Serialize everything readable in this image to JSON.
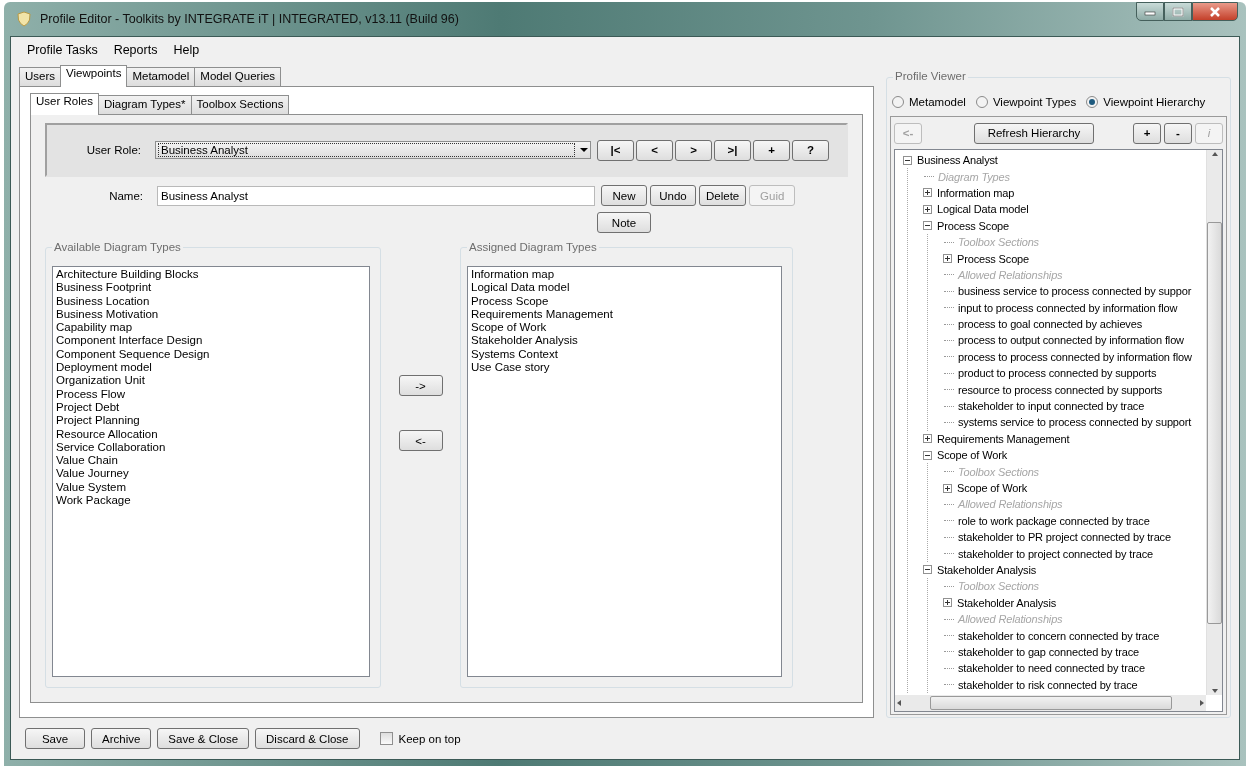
{
  "window": {
    "title": "Profile Editor - Toolkits by INTEGRATE iT | INTEGRATED, v13.11 (Build 96)"
  },
  "menu": [
    "Profile Tasks",
    "Reports",
    "Help"
  ],
  "tabs": [
    {
      "label": "Users",
      "selected": false
    },
    {
      "label": "Viewpoints",
      "selected": true
    },
    {
      "label": "Metamodel",
      "selected": false
    },
    {
      "label": "Model Queries",
      "selected": false
    }
  ],
  "subtabs": [
    {
      "label": "User Roles",
      "selected": true
    },
    {
      "label": "Diagram Types*",
      "selected": false
    },
    {
      "label": "Toolbox Sections",
      "selected": false
    }
  ],
  "user_role": {
    "label": "User Role:",
    "value": "Business Analyst"
  },
  "nav_buttons": [
    "|<",
    "<",
    ">",
    ">|",
    "+",
    "?"
  ],
  "name_field": {
    "label": "Name:",
    "value": "Business Analyst"
  },
  "name_buttons": [
    {
      "label": "New",
      "disabled": false
    },
    {
      "label": "Undo",
      "disabled": false
    },
    {
      "label": "Delete",
      "disabled": false
    },
    {
      "label": "Guid",
      "disabled": true
    }
  ],
  "note_button": "Note",
  "available": {
    "title": "Available Diagram Types",
    "items": [
      "Architecture Building Blocks",
      "Business Footprint",
      "Business Location",
      "Business Motivation",
      "Capability map",
      "Component Interface Design",
      "Component Sequence Design",
      "Deployment model",
      "Organization Unit",
      "Process Flow",
      "Project Debt",
      "Project Planning",
      "Resource Allocation",
      "Service Collaboration",
      "Value Chain",
      "Value Journey",
      "Value System",
      "Work Package"
    ]
  },
  "move_buttons": [
    "->",
    "<-"
  ],
  "assigned": {
    "title": "Assigned Diagram Types",
    "items": [
      "Information map",
      "Logical Data model",
      "Process Scope",
      "Requirements Management",
      "Scope of Work",
      "Stakeholder Analysis",
      "Systems Context",
      "Use Case story"
    ]
  },
  "profile_viewer": {
    "title": "Profile Viewer",
    "modes": [
      {
        "label": "Metamodel",
        "selected": false
      },
      {
        "label": "Viewpoint Types",
        "selected": false
      },
      {
        "label": "Viewpoint Hierarchy",
        "selected": true
      }
    ],
    "back_button": {
      "label": "<-",
      "disabled": true
    },
    "refresh_button": "Refresh Hierarchy",
    "tool_buttons": [
      {
        "label": "+",
        "disabled": false
      },
      {
        "label": "-",
        "disabled": false
      },
      {
        "label": "i",
        "disabled": true
      }
    ],
    "tree": [
      {
        "label": "Business Analyst",
        "kind": "node",
        "expanded": true,
        "children": [
          {
            "label": "Diagram Types",
            "kind": "heading"
          },
          {
            "label": "Information map",
            "kind": "node",
            "expanded": false
          },
          {
            "label": "Logical Data model",
            "kind": "node",
            "expanded": false
          },
          {
            "label": "Process Scope",
            "kind": "node",
            "expanded": true,
            "children": [
              {
                "label": "Toolbox Sections",
                "kind": "heading"
              },
              {
                "label": "Process Scope",
                "kind": "node",
                "expanded": false
              },
              {
                "label": "Allowed Relationships",
                "kind": "heading"
              },
              {
                "label": "business service to process connected by suppor",
                "kind": "leaf"
              },
              {
                "label": "input to process connected by information flow",
                "kind": "leaf"
              },
              {
                "label": "process to goal connected by achieves",
                "kind": "leaf"
              },
              {
                "label": "process to output connected by information flow",
                "kind": "leaf"
              },
              {
                "label": "process to process connected by information flow",
                "kind": "leaf"
              },
              {
                "label": "product to process connected by supports",
                "kind": "leaf"
              },
              {
                "label": "resource to process connected by supports",
                "kind": "leaf"
              },
              {
                "label": "stakeholder to input connected by trace",
                "kind": "leaf"
              },
              {
                "label": "systems service to process connected by support",
                "kind": "leaf"
              }
            ]
          },
          {
            "label": "Requirements Management",
            "kind": "node",
            "expanded": false
          },
          {
            "label": "Scope of Work",
            "kind": "node",
            "expanded": true,
            "children": [
              {
                "label": "Toolbox Sections",
                "kind": "heading"
              },
              {
                "label": "Scope of Work",
                "kind": "node",
                "expanded": false
              },
              {
                "label": "Allowed Relationships",
                "kind": "heading"
              },
              {
                "label": "role to work package connected by trace",
                "kind": "leaf"
              },
              {
                "label": "stakeholder to PR project connected by trace",
                "kind": "leaf"
              },
              {
                "label": "stakeholder to project connected by trace",
                "kind": "leaf"
              }
            ]
          },
          {
            "label": "Stakeholder Analysis",
            "kind": "node",
            "expanded": true,
            "children": [
              {
                "label": "Toolbox Sections",
                "kind": "heading"
              },
              {
                "label": "Stakeholder Analysis",
                "kind": "node",
                "expanded": false
              },
              {
                "label": "Allowed Relationships",
                "kind": "heading"
              },
              {
                "label": "stakeholder to concern connected by trace",
                "kind": "leaf"
              },
              {
                "label": "stakeholder to gap connected by trace",
                "kind": "leaf"
              },
              {
                "label": "stakeholder to need connected by trace",
                "kind": "leaf"
              },
              {
                "label": "stakeholder to risk connected by trace",
                "kind": "leaf"
              }
            ]
          }
        ]
      }
    ]
  },
  "bottom_buttons": [
    "Save",
    "Archive",
    "Save & Close",
    "Discard & Close"
  ],
  "keep_on_top": {
    "label": "Keep on top",
    "checked": false
  }
}
